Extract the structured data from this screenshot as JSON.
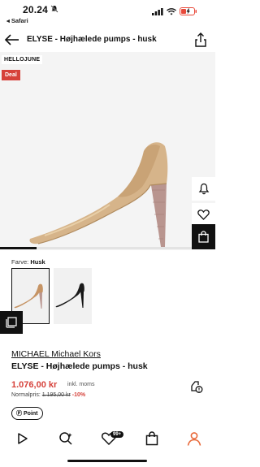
{
  "status_bar": {
    "time": "20.24",
    "back_app": "◂ Safari",
    "battery_color": "#e8493a"
  },
  "header": {
    "title": "ELYSE - Højhælede pumps - husk"
  },
  "product_image": {
    "brand_badge": "HELLOJUNE",
    "deal_badge": "Deal",
    "gallery_progress": 0.17
  },
  "colors": {
    "label_prefix": "Farve: ",
    "selected": "Husk",
    "options": [
      "husk",
      "black"
    ],
    "nude": "#d6b48a",
    "black": "#1a1a1a",
    "accent_red": "#d6413a"
  },
  "product": {
    "brand": "MICHAEL Michael Kors",
    "name": "ELYSE - Højhælede pumps - husk",
    "price": "1.076,00 kr",
    "price_note": "inkl. moms",
    "normal_price_label": "Normalpris:",
    "normal_price": "1.195,00 kr",
    "discount": "-10%",
    "point_label": "Point"
  },
  "nav": {
    "items": [
      "play-icon",
      "search-icon",
      "wishlist-icon",
      "bag-icon",
      "profile-icon"
    ],
    "wishlist_badge": "99+",
    "active_color": "#e8693a"
  }
}
